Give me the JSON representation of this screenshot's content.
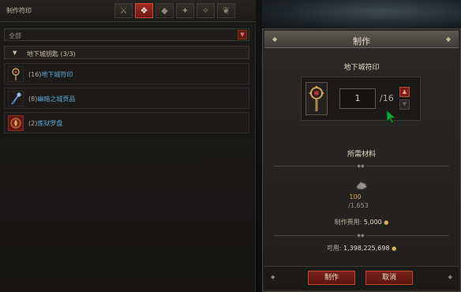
{
  "left_panel": {
    "title": "制作符印",
    "filter": {
      "value": "全部"
    },
    "category": {
      "label": "地下城钥匙 (3/3)"
    },
    "items": [
      {
        "count": "(16)",
        "name": "地下城符印",
        "icon": "sigil-icon"
      },
      {
        "count": "(8)",
        "name": "幽暗之城贡品",
        "icon": "tribute-icon"
      },
      {
        "count": "(2)",
        "name": "炼狱罗盘",
        "icon": "compass-icon"
      }
    ]
  },
  "craft_panel": {
    "title": "制作",
    "item_name": "地下城符印",
    "quantity": "1",
    "max": "/16",
    "required_title": "所需材料",
    "material": {
      "have": "100",
      "need": "/1,653",
      "icon": "material-icon"
    },
    "cost_label": "制作费用:",
    "cost_value": "5,000",
    "available_label": "可用:",
    "available_value": "1,398,225,698",
    "buttons": {
      "craft": "制作",
      "cancel": "取消"
    }
  },
  "colors": {
    "accent": "#a12a23",
    "link": "#5ea8d6",
    "gold": "#d5a850"
  }
}
